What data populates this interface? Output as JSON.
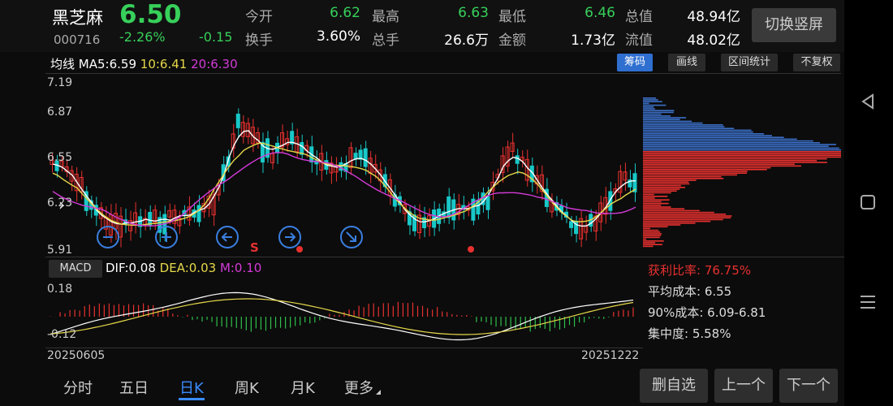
{
  "stock": {
    "name": "黑芝麻",
    "code": "000716",
    "price": "6.50",
    "change_pct": "-2.26%",
    "change": "-0.15"
  },
  "quote": {
    "open_label": "今开",
    "open": "6.62",
    "high_label": "最高",
    "high": "6.63",
    "low_label": "最低",
    "low": "6.46",
    "mktcap_label": "总值",
    "mktcap": "48.94亿",
    "turnover_label": "换手",
    "turnover": "3.60%",
    "volume_label": "总手",
    "volume": "26.6万",
    "amount_label": "金额",
    "amount": "1.73亿",
    "float_label": "流值",
    "float": "48.02亿"
  },
  "toolbar": {
    "vertical_label": "切换竖屏",
    "chips_label": "筹码",
    "draw_label": "画线",
    "range_stats_label": "区间统计",
    "adjust_label": "不复权"
  },
  "ma": {
    "title": "均线",
    "ma5": "MA5:6.59",
    "ma10": "10:6.41",
    "ma20": "20:6.30"
  },
  "price_axis": {
    "top": "7.19",
    "l2": "6.87",
    "l3": "6.55",
    "l4": "6.23",
    "bottom": "5.91"
  },
  "macd": {
    "label": "MACD",
    "dif": "DIF:0.08",
    "dea": "DEA:0.03",
    "m": "M:0.10",
    "axis_top": "0.18",
    "axis_bottom": "-0.12"
  },
  "dates": {
    "start": "20250605",
    "end": "20251222"
  },
  "marker": {
    "s": "S"
  },
  "chip_stats": {
    "profit_ratio": "获利比率: 76.75%",
    "avg_cost": "平均成本: 6.55",
    "cost90": "90%成本: 6.09-6.81",
    "concentration": "集中度: 5.58%"
  },
  "tabs": [
    "分时",
    "五日",
    "日K",
    "周K",
    "月K",
    "更多"
  ],
  "bottom_buttons": {
    "remove": "删自选",
    "prev": "上一个",
    "next": "下一个"
  },
  "colors": {
    "up": "#e8312f",
    "down": "#19c8c8",
    "ma5": "#ffffff",
    "ma10": "#e6d84a",
    "ma20": "#d43ad8",
    "accent": "#2f6fd0"
  }
}
